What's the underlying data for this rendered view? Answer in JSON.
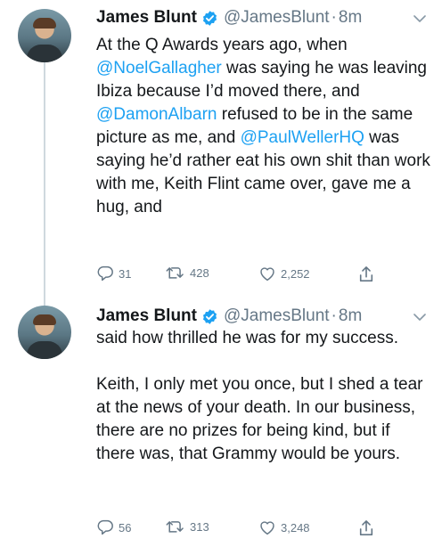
{
  "tweets": [
    {
      "author_name": "James Blunt",
      "handle": "@JamesBlunt",
      "separator": "·",
      "time": "8m",
      "text_parts": [
        "At the Q Awards years ago, when ",
        "@NoelGallagher",
        " was saying he was leaving Ibiza because I’d moved there, and ",
        "@DamonAlbarn",
        " refused to be in the same picture as me, and ",
        "@PaulWellerHQ",
        " was saying he’d rather eat his own shit than work with me, Keith Flint came over, gave me a hug, and"
      ],
      "reply_count": "31",
      "retweet_count": "428",
      "like_count": "2,252"
    },
    {
      "author_name": "James Blunt",
      "handle": "@JamesBlunt",
      "separator": "·",
      "time": "8m",
      "paragraph_1": "said how thrilled he was for my success.",
      "paragraph_2": "Keith, I only met you once, but I shed a tear at the news of your death. In our business, there are no prizes for being kind, but if there was, that Grammy would be yours.",
      "reply_count": "56",
      "retweet_count": "313",
      "like_count": "3,248"
    }
  ],
  "colors": {
    "text": "#14171a",
    "secondary": "#657786",
    "link": "#1da1f2",
    "verified": "#1da1f2",
    "thread_line": "#cfd9de"
  },
  "icons": [
    "verified-badge-icon",
    "chevron-down-icon",
    "reply-icon",
    "retweet-icon",
    "like-icon",
    "share-icon"
  ]
}
